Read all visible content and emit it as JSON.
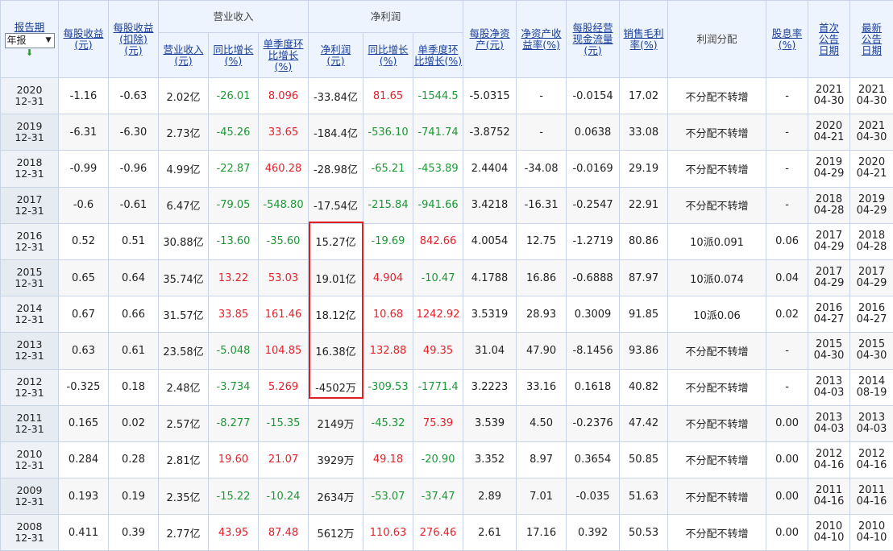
{
  "header": {
    "report_period": "报告期",
    "period_select": "年报",
    "sort_icon": "▼",
    "eps": "每股收益(元)",
    "eps_diluted": "每股收益(扣除)(元)",
    "revenue_group": "营业收入",
    "revenue": "营业收入(元)",
    "revenue_yoy": "同比增长(%)",
    "revenue_qoq": "单季度环比增长(%)",
    "profit_group": "净利润",
    "net_profit": "净利润(元)",
    "profit_yoy": "同比增长(%)",
    "profit_qoq": "单季度环比增长(%)",
    "bvps": "每股净资产(元)",
    "roe": "净资产收益率(%)",
    "ocfps": "每股经营现金流量(元)",
    "gross_margin": "销售毛利率(%)",
    "dividend": "利润分配",
    "div_yield": "股息率(%)",
    "first_pub": "首次公告日期",
    "latest_pub": "最新公告日期"
  },
  "rows": [
    {
      "y": "2020",
      "md": "12-31",
      "eps": "-1.16",
      "eps2": "-0.63",
      "rev": "2.02亿",
      "rev_yoy": "-26.01",
      "rev_qoq": "8.096",
      "np": "-33.84亿",
      "np_yoy": "81.65",
      "np_qoq": "-1544.5",
      "bvps": "-5.0315",
      "roe": "-",
      "ocf": "-0.0154",
      "gm": "17.02",
      "div": "不分配不转增",
      "dy": "-",
      "f1": "2021",
      "f2": "04-30",
      "l1": "2021",
      "l2": "04-30"
    },
    {
      "y": "2019",
      "md": "12-31",
      "eps": "-6.31",
      "eps2": "-6.30",
      "rev": "2.73亿",
      "rev_yoy": "-45.26",
      "rev_qoq": "33.65",
      "np": "-184.4亿",
      "np_yoy": "-536.10",
      "np_qoq": "-741.74",
      "bvps": "-3.8752",
      "roe": "-",
      "ocf": "0.0638",
      "gm": "33.08",
      "div": "不分配不转增",
      "dy": "-",
      "f1": "2020",
      "f2": "04-21",
      "l1": "2021",
      "l2": "04-30"
    },
    {
      "y": "2018",
      "md": "12-31",
      "eps": "-0.99",
      "eps2": "-0.96",
      "rev": "4.99亿",
      "rev_yoy": "-22.87",
      "rev_qoq": "460.28",
      "np": "-28.98亿",
      "np_yoy": "-65.21",
      "np_qoq": "-453.89",
      "bvps": "2.4404",
      "roe": "-34.08",
      "ocf": "-0.0169",
      "gm": "29.19",
      "div": "不分配不转增",
      "dy": "-",
      "f1": "2019",
      "f2": "04-29",
      "l1": "2020",
      "l2": "04-21"
    },
    {
      "y": "2017",
      "md": "12-31",
      "eps": "-0.6",
      "eps2": "-0.61",
      "rev": "6.47亿",
      "rev_yoy": "-79.05",
      "rev_qoq": "-548.80",
      "np": "-17.54亿",
      "np_yoy": "-215.84",
      "np_qoq": "-941.66",
      "bvps": "3.4218",
      "roe": "-16.31",
      "ocf": "-0.2547",
      "gm": "22.91",
      "div": "不分配不转增",
      "dy": "-",
      "f1": "2018",
      "f2": "04-28",
      "l1": "2019",
      "l2": "04-29"
    },
    {
      "y": "2016",
      "md": "12-31",
      "eps": "0.52",
      "eps2": "0.51",
      "rev": "30.88亿",
      "rev_yoy": "-13.60",
      "rev_qoq": "-35.60",
      "np": "15.27亿",
      "np_yoy": "-19.69",
      "np_qoq": "842.66",
      "bvps": "4.0054",
      "roe": "12.75",
      "ocf": "-1.2719",
      "gm": "80.86",
      "div": "10派0.091",
      "dy": "0.06",
      "f1": "2017",
      "f2": "04-29",
      "l1": "2018",
      "l2": "04-28"
    },
    {
      "y": "2015",
      "md": "12-31",
      "eps": "0.65",
      "eps2": "0.64",
      "rev": "35.74亿",
      "rev_yoy": "13.22",
      "rev_qoq": "53.03",
      "np": "19.01亿",
      "np_yoy": "4.904",
      "np_qoq": "-10.47",
      "bvps": "4.1788",
      "roe": "16.86",
      "ocf": "-0.6888",
      "gm": "87.97",
      "div": "10派0.074",
      "dy": "0.04",
      "f1": "2017",
      "f2": "04-29",
      "l1": "2017",
      "l2": "04-29"
    },
    {
      "y": "2014",
      "md": "12-31",
      "eps": "0.67",
      "eps2": "0.66",
      "rev": "31.57亿",
      "rev_yoy": "33.85",
      "rev_qoq": "161.46",
      "np": "18.12亿",
      "np_yoy": "10.68",
      "np_qoq": "1242.92",
      "bvps": "3.5319",
      "roe": "28.93",
      "ocf": "0.3009",
      "gm": "91.85",
      "div": "10派0.06",
      "dy": "0.02",
      "f1": "2016",
      "f2": "04-27",
      "l1": "2016",
      "l2": "04-27"
    },
    {
      "y": "2013",
      "md": "12-31",
      "eps": "0.63",
      "eps2": "0.61",
      "rev": "23.58亿",
      "rev_yoy": "-5.048",
      "rev_qoq": "104.85",
      "np": "16.38亿",
      "np_yoy": "132.88",
      "np_qoq": "49.35",
      "bvps": "31.04",
      "roe": "47.90",
      "ocf": "-8.1456",
      "gm": "93.86",
      "div": "不分配不转增",
      "dy": "-",
      "f1": "2015",
      "f2": "04-30",
      "l1": "2015",
      "l2": "04-30"
    },
    {
      "y": "2012",
      "md": "12-31",
      "eps": "-0.325",
      "eps2": "0.18",
      "rev": "2.48亿",
      "rev_yoy": "-3.734",
      "rev_qoq": "5.269",
      "np": "-4502万",
      "np_yoy": "-309.53",
      "np_qoq": "-1771.4",
      "bvps": "3.2223",
      "roe": "33.16",
      "ocf": "0.1618",
      "gm": "40.82",
      "div": "不分配不转增",
      "dy": "-",
      "f1": "2013",
      "f2": "04-03",
      "l1": "2014",
      "l2": "08-19"
    },
    {
      "y": "2011",
      "md": "12-31",
      "eps": "0.165",
      "eps2": "0.02",
      "rev": "2.57亿",
      "rev_yoy": "-8.277",
      "rev_qoq": "-15.35",
      "np": "2149万",
      "np_yoy": "-45.32",
      "np_qoq": "75.39",
      "bvps": "3.539",
      "roe": "4.50",
      "ocf": "-0.2376",
      "gm": "47.42",
      "div": "不分配不转增",
      "dy": "0.00",
      "f1": "2013",
      "f2": "04-03",
      "l1": "2013",
      "l2": "04-03"
    },
    {
      "y": "2010",
      "md": "12-31",
      "eps": "0.284",
      "eps2": "0.28",
      "rev": "2.81亿",
      "rev_yoy": "19.60",
      "rev_qoq": "21.07",
      "np": "3929万",
      "np_yoy": "49.18",
      "np_qoq": "-20.90",
      "bvps": "3.352",
      "roe": "8.97",
      "ocf": "0.3654",
      "gm": "50.85",
      "div": "不分配不转增",
      "dy": "0.00",
      "f1": "2012",
      "f2": "04-16",
      "l1": "2012",
      "l2": "04-16"
    },
    {
      "y": "2009",
      "md": "12-31",
      "eps": "0.193",
      "eps2": "0.19",
      "rev": "2.35亿",
      "rev_yoy": "-15.22",
      "rev_qoq": "-10.24",
      "np": "2634万",
      "np_yoy": "-53.07",
      "np_qoq": "-37.47",
      "bvps": "2.89",
      "roe": "7.01",
      "ocf": "-0.035",
      "gm": "51.63",
      "div": "不分配不转增",
      "dy": "0.00",
      "f1": "2011",
      "f2": "04-16",
      "l1": "2011",
      "l2": "04-16"
    },
    {
      "y": "2008",
      "md": "12-31",
      "eps": "0.411",
      "eps2": "0.39",
      "rev": "2.77亿",
      "rev_yoy": "43.95",
      "rev_qoq": "87.48",
      "np": "5612万",
      "np_yoy": "110.63",
      "np_qoq": "276.46",
      "bvps": "2.61",
      "roe": "17.16",
      "ocf": "0.392",
      "gm": "50.53",
      "div": "不分配不转增",
      "dy": "0.00",
      "f1": "2010",
      "f2": "04-10",
      "l1": "2010",
      "l2": "04-10"
    }
  ],
  "colors": {
    "positive": "#e8202a",
    "negative": "#199a34",
    "header_text": "#1a3f9c",
    "highlight": "#e02020"
  }
}
